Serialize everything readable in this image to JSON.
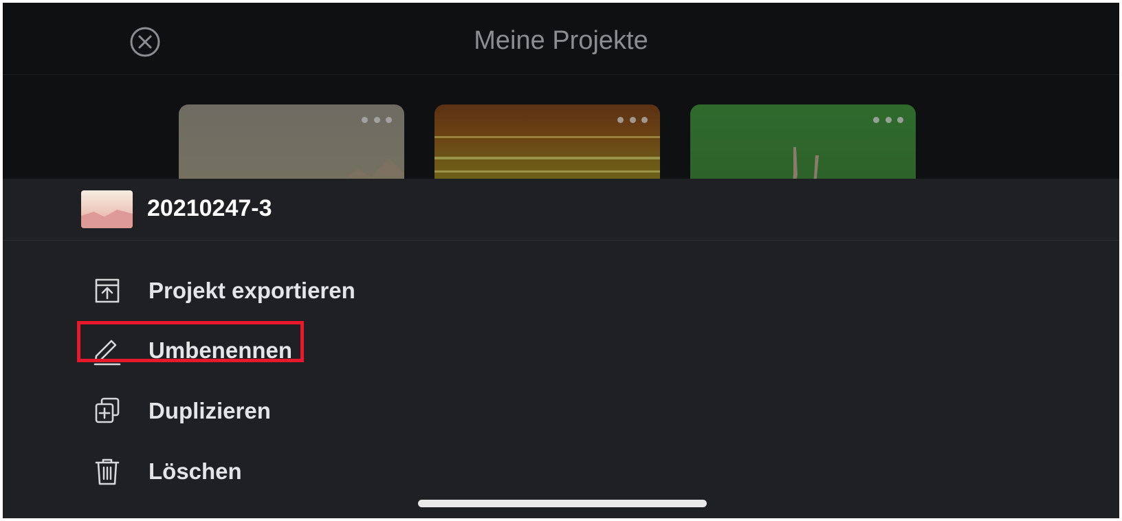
{
  "header": {
    "title": "Meine Projekte",
    "close_icon": "close-circle-icon"
  },
  "projects": [
    {
      "menu_icon": "more-dots-icon",
      "color": "#74705f"
    },
    {
      "menu_icon": "more-dots-icon",
      "color": "#6a4a15"
    },
    {
      "menu_icon": "more-dots-icon",
      "color": "#2e662b"
    }
  ],
  "sheet": {
    "project_name": "20210247-3",
    "items": [
      {
        "label": "Projekt exportieren",
        "icon": "export-icon"
      },
      {
        "label": "Umbenennen",
        "icon": "pencil-icon"
      },
      {
        "label": "Duplizieren",
        "icon": "duplicate-icon"
      },
      {
        "label": "Löschen",
        "icon": "trash-icon"
      }
    ]
  },
  "colors": {
    "background": "#0f1012",
    "sheet": "#1f2024",
    "highlight": "#e8192c",
    "text": "#e4e5e7",
    "title": "#8b8d91"
  }
}
